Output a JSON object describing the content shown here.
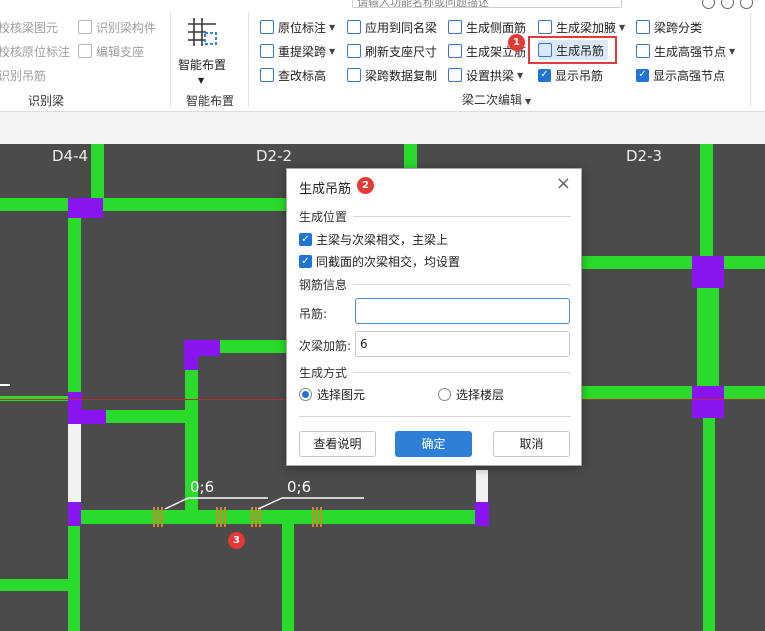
{
  "search": {
    "placeholder": "请输入功能名称或问题描述"
  },
  "ribbon": {
    "left_col1": [
      "校核梁图元",
      "校核原位标注",
      "识别吊筋"
    ],
    "left_col2": [
      "识别梁构件",
      "编辑支座"
    ],
    "group_identify_beam": "识别梁",
    "smart_layout": {
      "label": "智能布置",
      "group": "智能布置"
    },
    "col_a": [
      "原位标注",
      "重提梁跨",
      "查改标高"
    ],
    "col_b": [
      "应用到同名梁",
      "刷新支座尺寸",
      "梁跨数据复制"
    ],
    "col_c": [
      "生成侧面筋",
      "生成架立筋",
      "设置拱梁"
    ],
    "col_d": [
      "生成梁加腋",
      "生成吊筋",
      "显示吊筋"
    ],
    "col_e": [
      "梁跨分类",
      "生成高强节点",
      "显示高强节点"
    ],
    "group_beam_edit": "梁二次编辑"
  },
  "canvas": {
    "axis_labels": [
      "D4-4",
      "D2-2",
      "D2-3"
    ],
    "dim_labels": [
      "0;6",
      "0;6"
    ]
  },
  "dialog": {
    "title": "生成吊筋",
    "close": "×",
    "section_position": "生成位置",
    "check_main_beam": "主梁与次梁相交，主梁上",
    "check_same_section": "同截面的次梁相交，均设置",
    "section_rebar": "钢筋信息",
    "label_hanger": "吊筋:",
    "value_hanger": "",
    "label_secondary": "次梁加筋:",
    "value_secondary": "6",
    "section_method": "生成方式",
    "radio_element": "选择图元",
    "radio_floor": "选择楼层",
    "btn_help": "查看说明",
    "btn_ok": "确定",
    "btn_cancel": "取消"
  },
  "badges": [
    "1",
    "2",
    "3"
  ],
  "colors": {
    "beam_green": "#2bdb2b",
    "support_purple": "#8a14ef",
    "canvas_bg": "#4b4b4b",
    "highlight_red": "#e23b3b",
    "primary_blue": "#2d7fd8"
  }
}
